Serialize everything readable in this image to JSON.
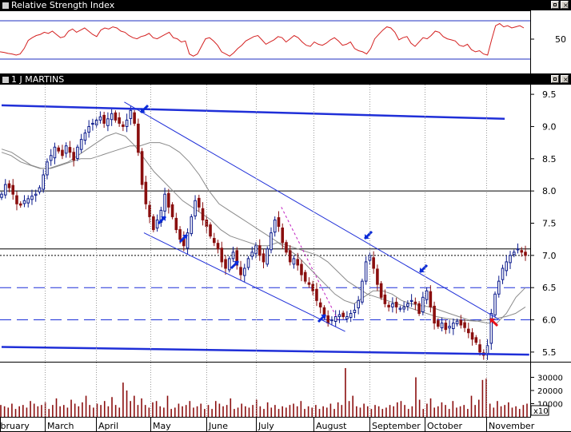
{
  "rsi_panel": {
    "title": "Relative Strength Index",
    "tick": "50"
  },
  "price_panel": {
    "title": "1 J MARTINS"
  },
  "scale_label": "x10",
  "chart_data": [
    {
      "type": "line",
      "title": "Relative Strength Index",
      "ylim": [
        0,
        100
      ],
      "yticks": [
        50
      ],
      "reference_lines": [
        70,
        30
      ],
      "series": [
        {
          "values": [
            34,
            33,
            31,
            30,
            28,
            30,
            40,
            55,
            60,
            64,
            66,
            70,
            68,
            72,
            66,
            60,
            62,
            72,
            76,
            70,
            74,
            78,
            72,
            66,
            62,
            74,
            78,
            76,
            80,
            78,
            72,
            70,
            64,
            60,
            58,
            62,
            64,
            68,
            60,
            58,
            62,
            66,
            70,
            60,
            58,
            52,
            54,
            30,
            26,
            30,
            44,
            58,
            60,
            54,
            46,
            34,
            30,
            26,
            32,
            40,
            46,
            54,
            58,
            62,
            64,
            56,
            48,
            52,
            56,
            62,
            60,
            52,
            58,
            64,
            60,
            52,
            46,
            44,
            52,
            48,
            46,
            50,
            56,
            60,
            54,
            46,
            48,
            52,
            40,
            36,
            34,
            30,
            40,
            58,
            66,
            74,
            80,
            78,
            70,
            56,
            60,
            62,
            50,
            44,
            52,
            60,
            58,
            64,
            72,
            70,
            62,
            58,
            56,
            54,
            46,
            44,
            48,
            38,
            34,
            36,
            30,
            28,
            56,
            82,
            86,
            80,
            82,
            78,
            80,
            82,
            78
          ]
        }
      ]
    },
    {
      "type": "candlestick",
      "title": "1 J MARTINS",
      "ylim": [
        5.35,
        9.65
      ],
      "yticks": [
        "9.5",
        "9.0",
        "8.5",
        "8.0",
        "7.5",
        "7.0",
        "6.5",
        "6.0",
        "5.5"
      ],
      "grid": false,
      "horizontal_lines": [
        {
          "value": 8.0,
          "style": "solid"
        },
        {
          "value": 7.1,
          "style": "solid"
        },
        {
          "value": 7.0,
          "style": "dotted"
        },
        {
          "value": 6.5,
          "style": "dashed"
        },
        {
          "value": 6.0,
          "style": "dashed"
        }
      ],
      "x_months": [
        "February",
        "March",
        "April",
        "May",
        "June",
        "July",
        "August",
        "September",
        "October",
        "November"
      ],
      "close": [
        7.95,
        8.1,
        8.05,
        7.95,
        7.8,
        7.78,
        7.85,
        7.88,
        7.92,
        7.95,
        8.05,
        8.25,
        8.45,
        8.55,
        8.68,
        8.62,
        8.55,
        8.7,
        8.6,
        8.48,
        8.68,
        8.8,
        8.9,
        9.0,
        9.05,
        9.1,
        9.15,
        9.05,
        9.12,
        9.2,
        9.1,
        9.05,
        9.0,
        9.1,
        9.25,
        9.05,
        8.6,
        8.1,
        7.8,
        7.6,
        7.4,
        7.55,
        7.7,
        7.95,
        7.75,
        7.6,
        7.4,
        7.25,
        7.15,
        7.35,
        7.6,
        7.85,
        7.75,
        7.55,
        7.45,
        7.3,
        7.2,
        7.1,
        6.9,
        6.8,
        6.95,
        7.05,
        6.85,
        6.7,
        6.8,
        6.95,
        7.05,
        7.15,
        7.0,
        6.9,
        7.1,
        7.35,
        7.55,
        7.45,
        7.2,
        7.05,
        6.9,
        6.95,
        6.85,
        6.7,
        6.6,
        6.55,
        6.45,
        6.3,
        6.2,
        6.05,
        5.95,
        6.0,
        6.05,
        6.08,
        6.05,
        6.05,
        6.1,
        6.15,
        6.3,
        6.6,
        6.9,
        7.0,
        6.8,
        6.55,
        6.35,
        6.25,
        6.2,
        6.25,
        6.2,
        6.18,
        6.2,
        6.25,
        6.3,
        6.25,
        6.1,
        6.35,
        6.45,
        6.2,
        5.95,
        5.9,
        5.95,
        5.85,
        5.9,
        5.95,
        5.98,
        5.92,
        5.88,
        5.8,
        5.7,
        5.65,
        5.5,
        5.45,
        5.6,
        6.1,
        6.4,
        6.6,
        6.8,
        6.9,
        7.0,
        7.05,
        7.1,
        7.05,
        7.0
      ],
      "moving_averages": [
        {
          "values": [
            8.6,
            8.55,
            8.45,
            8.4,
            8.35,
            8.35,
            8.4,
            8.45,
            8.55,
            8.65,
            8.75,
            8.85,
            8.9,
            8.85,
            8.7,
            8.5,
            8.3,
            8.15,
            8.0,
            7.85,
            7.75,
            7.65,
            7.55,
            7.4,
            7.3,
            7.25,
            7.2,
            7.15,
            7.15,
            7.2,
            7.1,
            7.0,
            6.85,
            6.7,
            6.55,
            6.4,
            6.3,
            6.25,
            6.35,
            6.45,
            6.45,
            6.4,
            6.3,
            6.25,
            6.22,
            6.2,
            6.15,
            6.1,
            6.05,
            6.0,
            5.98,
            5.95,
            5.95,
            6.1,
            6.35,
            6.5
          ]
        },
        {
          "values": [
            8.65,
            8.6,
            8.5,
            8.4,
            8.35,
            8.35,
            8.4,
            8.45,
            8.5,
            8.5,
            8.55,
            8.6,
            8.65,
            8.7,
            8.7,
            8.75,
            8.75,
            8.7,
            8.6,
            8.45,
            8.25,
            8.0,
            7.8,
            7.7,
            7.6,
            7.5,
            7.4,
            7.3,
            7.2,
            7.15,
            7.1,
            7.05,
            7.0,
            6.9,
            6.75,
            6.6,
            6.5,
            6.4,
            6.35,
            6.3,
            6.25,
            6.2,
            6.15,
            6.1,
            6.05,
            6.02,
            6.0,
            5.99,
            5.98,
            6.0,
            6.02,
            6.05,
            6.1,
            6.2
          ]
        }
      ],
      "trend_lines": [
        {
          "from": [
            0,
            9.33
          ],
          "to": [
            205,
            9.12
          ]
        },
        {
          "from": [
            0,
            5.58
          ],
          "to": [
            215,
            5.46
          ]
        },
        {
          "from": [
            50,
            9.38
          ],
          "to": [
            203,
            6.0
          ]
        },
        {
          "from": [
            58,
            7.35
          ],
          "to": [
            140,
            5.82
          ]
        },
        {
          "from": [
            114,
            7.75
          ],
          "to": [
            137,
            6.0
          ]
        }
      ]
    },
    {
      "type": "bar",
      "title": "Volume",
      "yticks": [
        "30000",
        "20000",
        "10000"
      ],
      "unit_label": "x10",
      "values": [
        9000,
        8000,
        7000,
        10000,
        6000,
        8000,
        9000,
        7000,
        12000,
        10000,
        8000,
        9000,
        11000,
        6000,
        9000,
        14000,
        8000,
        9000,
        7000,
        13000,
        10000,
        8000,
        11000,
        16000,
        9000,
        7000,
        10000,
        9000,
        12000,
        8000,
        15000,
        9000,
        7000,
        26000,
        20000,
        12000,
        16000,
        9000,
        14000,
        9000,
        7000,
        11000,
        12000,
        8000,
        7000,
        16000,
        6000,
        7000,
        10000,
        8000,
        9000,
        12000,
        7000,
        8000,
        10000,
        6000,
        9000,
        6000,
        12000,
        10000,
        8000,
        9000,
        14000,
        6000,
        7000,
        10000,
        8000,
        7000,
        9000,
        13000,
        8000,
        6000,
        11000,
        7000,
        9000,
        6000,
        8000,
        7000,
        9000,
        10000,
        8000,
        12000,
        6000,
        8000,
        7000,
        9000,
        6000,
        8000,
        7000,
        10000,
        6000,
        11000,
        9000,
        37000,
        12000,
        16000,
        8000,
        7000,
        10000,
        8000,
        6000,
        9000,
        8000,
        6000,
        7000,
        9000,
        8000,
        11000,
        12000,
        9000,
        6000,
        8000,
        30000,
        13000,
        6000,
        10000,
        14000,
        7000,
        8000,
        11000,
        9000,
        6000,
        12000,
        7000,
        8000,
        9000,
        6000,
        16000,
        9000,
        13000,
        28000,
        29000,
        10000,
        7000,
        12000,
        8000,
        9000,
        11000,
        7000,
        8000,
        6000,
        9000,
        10000
      ]
    }
  ],
  "annotations": {
    "arrow_color_blue": "#0a2bd8",
    "arrow_color_red": "#e8101a",
    "blue_arrows": 8,
    "red_arrows": 1
  },
  "colors": {
    "rsi_line": "#d42020",
    "rsi_ref": "#1f2fc0",
    "trend": "#1f2fd8",
    "up_candle": "#0b1a8c",
    "down_candle": "#8a0f0f",
    "ma_line": "#8a8a8a",
    "volume": "#8b0f0f"
  }
}
